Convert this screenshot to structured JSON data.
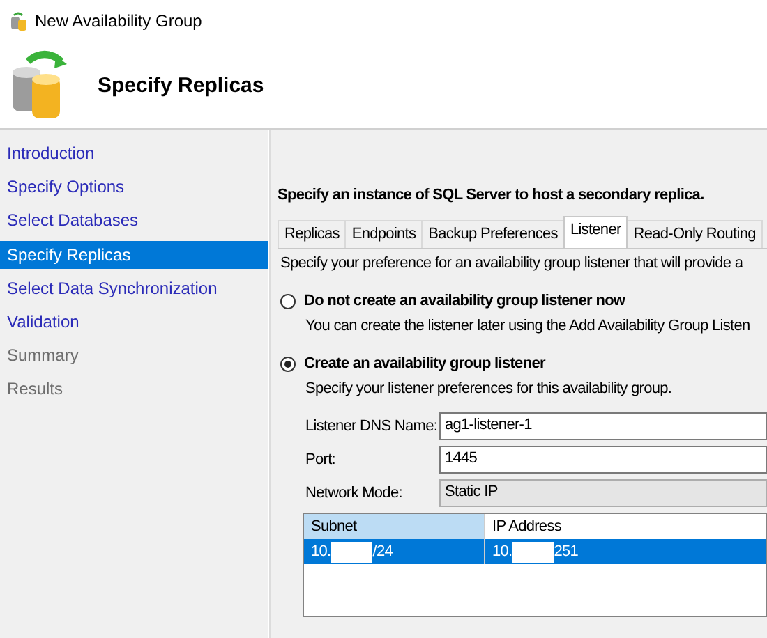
{
  "window": {
    "title": "New Availability Group"
  },
  "header": {
    "title": "Specify Replicas"
  },
  "sidebar": {
    "items": [
      {
        "label": "Introduction",
        "selected": false,
        "disabled": false
      },
      {
        "label": "Specify Options",
        "selected": false,
        "disabled": false
      },
      {
        "label": "Select Databases",
        "selected": false,
        "disabled": false
      },
      {
        "label": "Specify Replicas",
        "selected": true,
        "disabled": false
      },
      {
        "label": "Select Data Synchronization",
        "selected": false,
        "disabled": false
      },
      {
        "label": "Validation",
        "selected": false,
        "disabled": false
      },
      {
        "label": "Summary",
        "selected": false,
        "disabled": true
      },
      {
        "label": "Results",
        "selected": false,
        "disabled": true
      }
    ]
  },
  "main": {
    "heading": "Specify an instance of SQL Server to host a secondary replica.",
    "tabs": [
      {
        "label": "Replicas",
        "selected": false
      },
      {
        "label": "Endpoints",
        "selected": false
      },
      {
        "label": "Backup Preferences",
        "selected": false
      },
      {
        "label": "Listener",
        "selected": true
      },
      {
        "label": "Read-Only Routing",
        "selected": false
      }
    ],
    "intro": "Specify your preference for an availability group listener that will provide a",
    "options": [
      {
        "label": "Do not create an availability group listener now",
        "description": "You can create the listener later using the Add Availability Group Listen",
        "selected": false
      },
      {
        "label": "Create an availability group listener",
        "description": "Specify your listener preferences for this availability group.",
        "selected": true
      }
    ],
    "fields": [
      {
        "kind": "text",
        "label": "Listener DNS Name:",
        "value": "ag1-listener-1"
      },
      {
        "kind": "text",
        "label": "Port:",
        "value": "1445"
      },
      {
        "kind": "combo",
        "label": "Network Mode:",
        "value": "Static IP"
      }
    ],
    "table": {
      "columns": [
        {
          "label": "Subnet",
          "sorted": true
        },
        {
          "label": "IP Address",
          "sorted": false
        }
      ],
      "rows": [
        {
          "selected": true,
          "cells": [
            {
              "before": "10.",
              "after": "/24"
            },
            {
              "before": "10.",
              "after": "251"
            }
          ]
        }
      ]
    }
  }
}
